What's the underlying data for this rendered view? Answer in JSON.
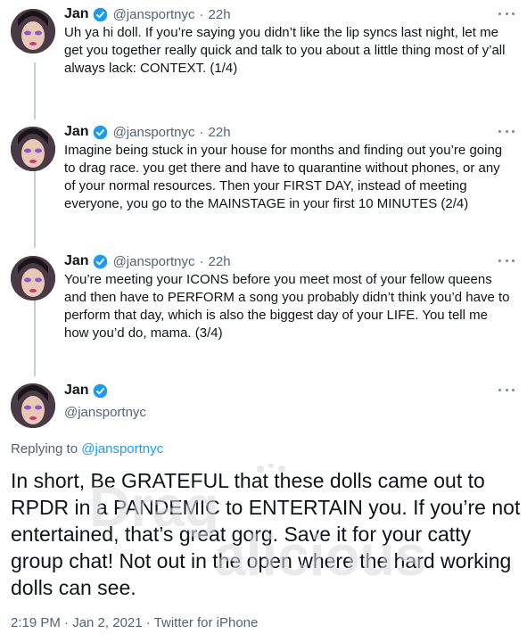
{
  "tweets": [
    {
      "name": "Jan",
      "handle": "@jansportnyc",
      "time": "22h",
      "text": "Uh ya hi doll. If you’re saying you didn’t like the lip syncs last night, let me get you together really quick and talk to you about a little thing most of y’all always lack: CONTEXT. (1/4)"
    },
    {
      "name": "Jan",
      "handle": "@jansportnyc",
      "time": "22h",
      "text": "Imagine being stuck in your house for months and finding out you’re going to drag race. you get there and have to quarantine without phones, or any of your normal resources. Then your FIRST DAY, instead of meeting everyone, you go to the MAINSTAGE in your first 10 MINUTES (2/4)"
    },
    {
      "name": "Jan",
      "handle": "@jansportnyc",
      "time": "22h",
      "text": "You’re meeting your ICONS before you meet most of your fellow queens and then have to PERFORM a song you probably didn’t think you’d have to perform that day, which is also the biggest day of your LIFE. You tell me how you’d do, mama. (3/4)"
    }
  ],
  "main": {
    "name": "Jan",
    "handle": "@jansportnyc",
    "replying_prefix": "Replying to",
    "replying_handle": "@jansportnyc",
    "text": "In short, Be GRATEFUL that these dolls came out to RPDR in a PANDEMIC to ENTERTAIN you. If you’re not entertained, that’s great gorg. Save it for your catty group chat! Not out in the open where the hard working dolls can see.",
    "timestamp": "2:19 PM · Jan 2, 2021 · Twitter for iPhone"
  },
  "separator": "·",
  "watermark": "Dragalicious",
  "icons": {
    "verified": "verified-badge-icon",
    "more": "more-options-icon"
  },
  "colors": {
    "verified": "#1d9bf0",
    "link": "#1d9bf0",
    "secondary_text": "#536471",
    "thread_line": "#c4cfd6"
  }
}
